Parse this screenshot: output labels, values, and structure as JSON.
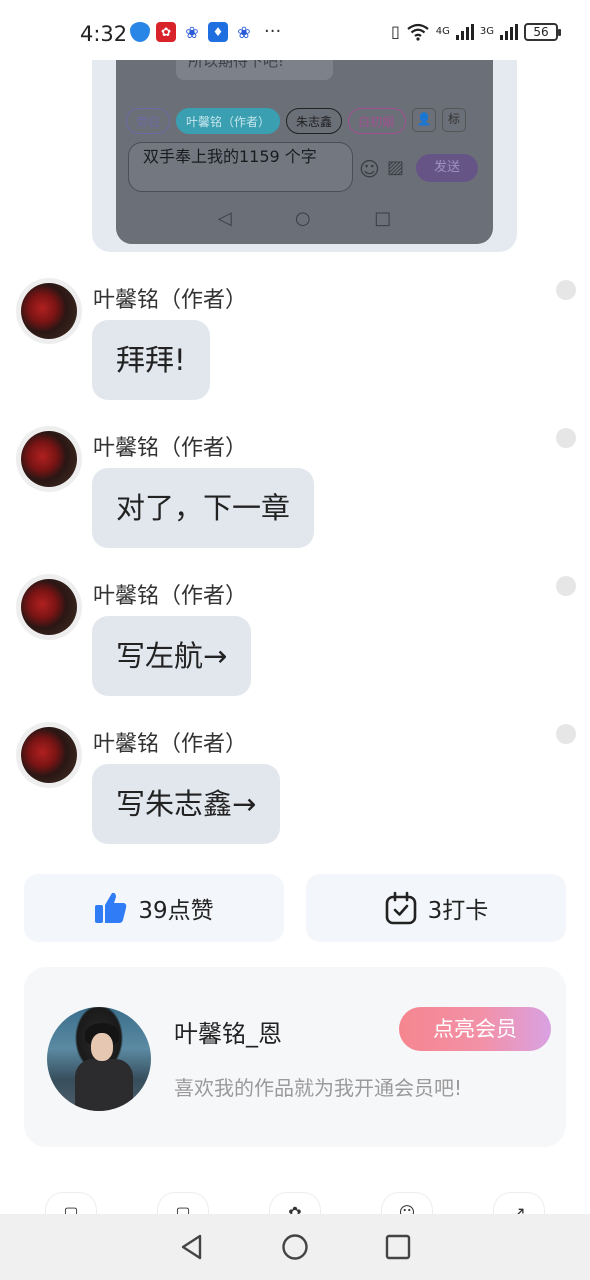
{
  "status_bar": {
    "time": "4:32",
    "net_left": "4G",
    "net_right": "3G",
    "battery": "56"
  },
  "preview": {
    "bubble_text": "所以期待下吧!",
    "chips": [
      "旁白",
      "叶馨铭（作者）",
      "朱志鑫",
      "白初姻"
    ],
    "icon_box_1": "👤",
    "icon_box_2": "标",
    "input_text": "双手奉上我的1159 个字",
    "send_label": "发送"
  },
  "messages": [
    {
      "sender": "叶馨铭（作者）",
      "text": "拜拜!"
    },
    {
      "sender": "叶馨铭（作者）",
      "text": "对了，下一章"
    },
    {
      "sender": "叶馨铭（作者）",
      "text": "写左航→"
    },
    {
      "sender": "叶馨铭（作者）",
      "text": "写朱志鑫→"
    }
  ],
  "actions": {
    "like_label": "39点赞",
    "punch_label": "3打卡"
  },
  "author_card": {
    "name": "叶馨铭_恩",
    "description": "喜欢我的作品就为我开通会员吧!",
    "vip_button": "点亮会员"
  },
  "colors": {
    "like_blue": "#2f7cf6",
    "bubble_bg": "#e2e7ee",
    "vip_start": "#f5868f",
    "vip_end": "#d9a2e3"
  }
}
